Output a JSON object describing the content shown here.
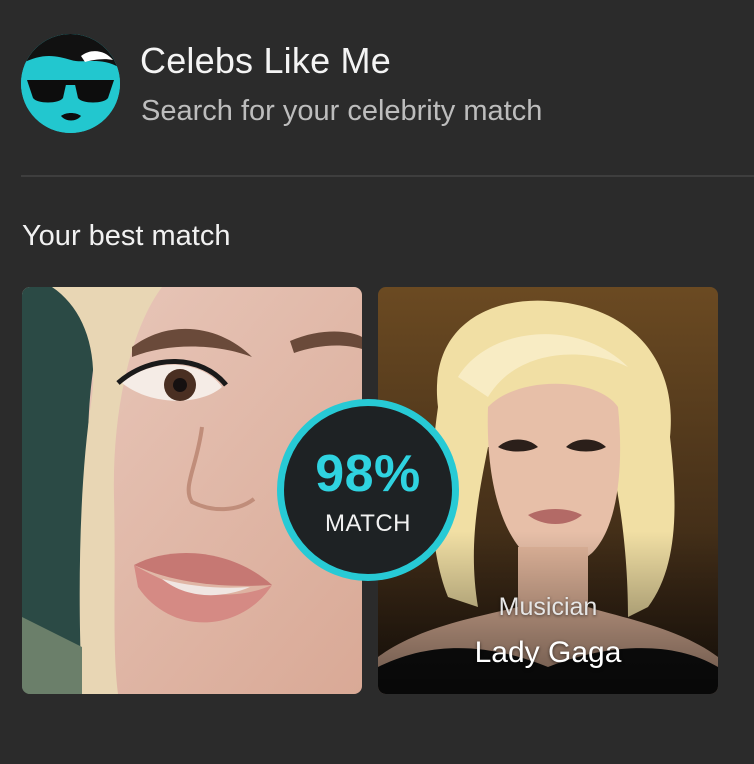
{
  "header": {
    "title": "Celebs Like Me",
    "subtitle": "Search for your celebrity match",
    "logo_icon": "sunglasses-face-icon"
  },
  "section": {
    "title": "Your best match"
  },
  "match": {
    "percent": "98%",
    "label": "MATCH",
    "accent_color": "#2fd3e0"
  },
  "celebrity": {
    "occupation": "Musician",
    "name": "Lady Gaga"
  }
}
